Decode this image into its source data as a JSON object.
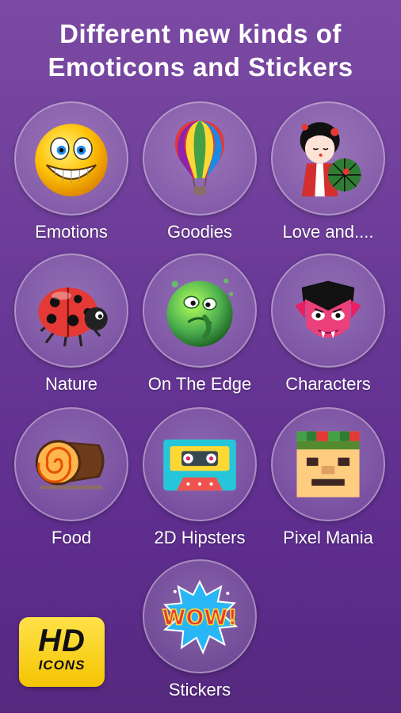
{
  "header": {
    "title_line1": "Different new kinds of",
    "title_line2": "Emoticons and Stickers"
  },
  "categories": [
    {
      "label": "Emotions",
      "icon": "smiley-face-icon"
    },
    {
      "label": "Goodies",
      "icon": "hot-air-balloon-icon"
    },
    {
      "label": "Love and....",
      "icon": "geisha-doll-icon"
    },
    {
      "label": "Nature",
      "icon": "ladybug-icon"
    },
    {
      "label": "On The Edge",
      "icon": "green-blob-icon"
    },
    {
      "label": "Characters",
      "icon": "vampire-face-icon"
    },
    {
      "label": "Food",
      "icon": "swiss-roll-icon"
    },
    {
      "label": "2D Hipsters",
      "icon": "cassette-tape-icon"
    },
    {
      "label": "Pixel Mania",
      "icon": "pixel-face-icon"
    },
    {
      "label": "Stickers",
      "icon": "wow-sticker-icon"
    }
  ],
  "badge": {
    "line1": "HD",
    "line2": "ICONS",
    "color": "#f4c400"
  }
}
